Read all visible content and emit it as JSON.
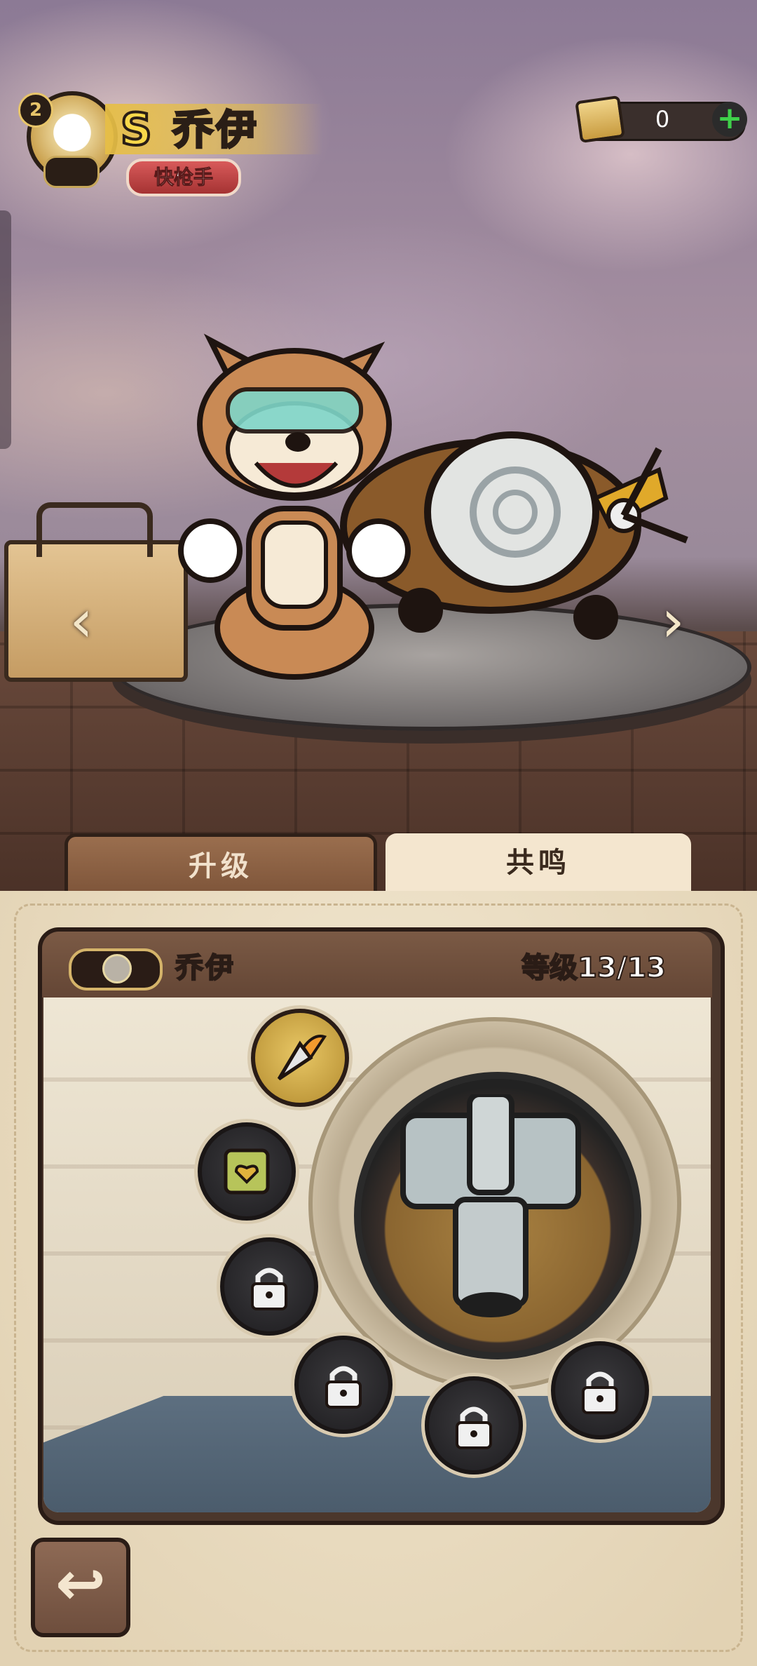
{
  "hero": {
    "rank": "S",
    "name": "乔伊",
    "role": "快枪手",
    "level_badge": "2"
  },
  "currency": {
    "value": "0",
    "plus_label": "+"
  },
  "nav": {
    "prev": "‹",
    "next": "›"
  },
  "tabs": [
    {
      "label": "升级",
      "active": false
    },
    {
      "label": "共鸣",
      "active": true
    }
  ],
  "panel": {
    "name": "乔伊",
    "level_text": "等级13/13"
  },
  "nodes": [
    {
      "name": "fire-drill-icon",
      "state": "unlocked"
    },
    {
      "name": "buff-icon",
      "state": "unlocked"
    },
    {
      "name": "lock-icon",
      "state": "locked"
    },
    {
      "name": "lock-icon",
      "state": "locked"
    },
    {
      "name": "lock-icon",
      "state": "locked"
    },
    {
      "name": "lock-icon",
      "state": "locked"
    }
  ],
  "back": {
    "label": "↩"
  },
  "colors": {
    "panel": "#e9dcc2",
    "card": "#4b372c",
    "accent_gold": "#e8c56a",
    "role_red": "#c24545"
  }
}
